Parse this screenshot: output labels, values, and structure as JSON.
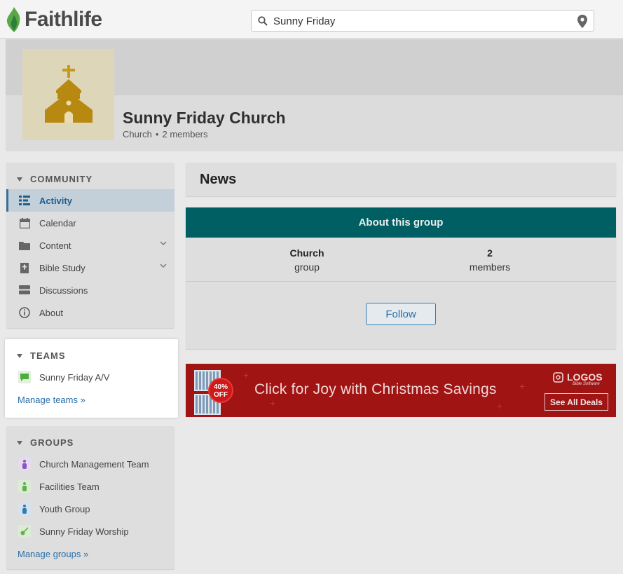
{
  "header": {
    "logo_text": "Faithlife",
    "search_value": "Sunny Friday"
  },
  "profile": {
    "name": "Sunny Friday Church",
    "type": "Church",
    "separator": "•",
    "members": "2 members"
  },
  "community": {
    "title": "COMMUNITY",
    "items": [
      {
        "label": "Activity",
        "icon": "activity-list-icon",
        "active": true
      },
      {
        "label": "Calendar",
        "icon": "calendar-icon"
      },
      {
        "label": "Content",
        "icon": "folder-icon",
        "expandable": true
      },
      {
        "label": "Bible Study",
        "icon": "bible-icon",
        "expandable": true
      },
      {
        "label": "Discussions",
        "icon": "discussions-icon"
      },
      {
        "label": "About",
        "icon": "info-icon"
      }
    ]
  },
  "teams": {
    "title": "TEAMS",
    "items": [
      {
        "label": "Sunny Friday A/V",
        "icon": "chat-bubble-icon"
      }
    ],
    "manage_link": "Manage teams »"
  },
  "groups": {
    "title": "GROUPS",
    "items": [
      {
        "label": "Church Management Team",
        "icon": "person-icon",
        "color": "#8a55c2"
      },
      {
        "label": "Facilities Team",
        "icon": "person-icon",
        "color": "#5fb24b"
      },
      {
        "label": "Youth Group",
        "icon": "person-icon",
        "color": "#2f7bb6"
      },
      {
        "label": "Sunny Friday Worship",
        "icon": "guitar-icon",
        "color": "#5fb24b"
      }
    ],
    "manage_link": "Manage groups »"
  },
  "main": {
    "news_title": "News",
    "about": {
      "title": "About this group",
      "stat1_value": "Church",
      "stat1_label": "group",
      "stat2_value": "2",
      "stat2_label": "members",
      "follow_label": "Follow"
    },
    "ad": {
      "discount": "40% OFF",
      "tagline": "Click for Joy with Christmas Savings",
      "brand": "LOGOS",
      "brand_sub": "Bible Software",
      "cta": "See All Deals"
    }
  },
  "colors": {
    "teal": "#005f63",
    "link": "#2a6ea8",
    "ad_red": "#a01414"
  }
}
